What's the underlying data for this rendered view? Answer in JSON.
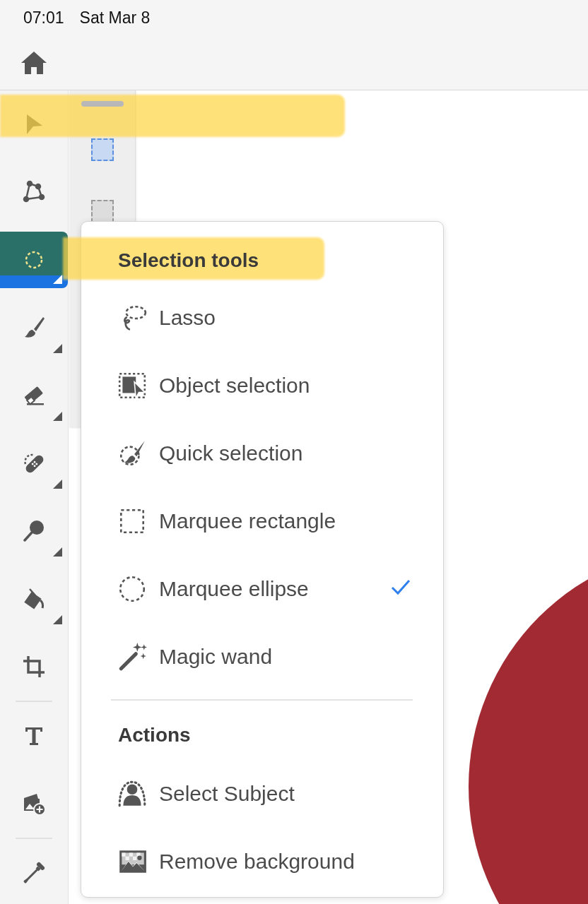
{
  "status_bar": {
    "time": "07:01",
    "date": "Sat Mar 8"
  },
  "toolbar": {
    "groups": [
      [
        {
          "kind": "select",
          "selected": false,
          "submenu": false,
          "highlighted": true
        },
        {
          "kind": "transform",
          "selected": false,
          "submenu": false,
          "highlighted": false
        },
        {
          "kind": "selection",
          "selected": true,
          "submenu": true,
          "highlighted": false
        },
        {
          "kind": "brush",
          "selected": false,
          "submenu": true,
          "highlighted": false
        },
        {
          "kind": "eraser",
          "selected": false,
          "submenu": true,
          "highlighted": false
        },
        {
          "kind": "heal",
          "selected": false,
          "submenu": true,
          "highlighted": false
        },
        {
          "kind": "smudge",
          "selected": false,
          "submenu": true,
          "highlighted": false
        },
        {
          "kind": "fill",
          "selected": false,
          "submenu": true,
          "highlighted": false
        },
        {
          "kind": "crop",
          "selected": false,
          "submenu": false,
          "highlighted": false
        }
      ],
      [
        {
          "kind": "text",
          "selected": false,
          "submenu": false,
          "highlighted": false
        },
        {
          "kind": "place",
          "selected": false,
          "submenu": false,
          "highlighted": false
        }
      ],
      [
        {
          "kind": "eyedropper",
          "selected": false,
          "submenu": false,
          "highlighted": false
        }
      ]
    ]
  },
  "layers": [
    {
      "selected": true
    },
    {
      "selected": false
    }
  ],
  "menu": {
    "sections": [
      {
        "heading": "Selection tools",
        "highlighted": true,
        "items": [
          {
            "kind": "lasso",
            "label": "Lasso",
            "checked": false
          },
          {
            "kind": "object",
            "label": "Object selection",
            "checked": false
          },
          {
            "kind": "quick",
            "label": "Quick selection",
            "checked": false
          },
          {
            "kind": "rect",
            "label": "Marquee rectangle",
            "checked": false
          },
          {
            "kind": "ellipse",
            "label": "Marquee ellipse",
            "checked": true
          },
          {
            "kind": "wand",
            "label": "Magic wand",
            "checked": false
          }
        ]
      },
      {
        "heading": "Actions",
        "highlighted": false,
        "items": [
          {
            "kind": "subject",
            "label": "Select Subject",
            "checked": false
          },
          {
            "kind": "removebg",
            "label": "Remove background",
            "checked": false
          }
        ]
      }
    ]
  }
}
